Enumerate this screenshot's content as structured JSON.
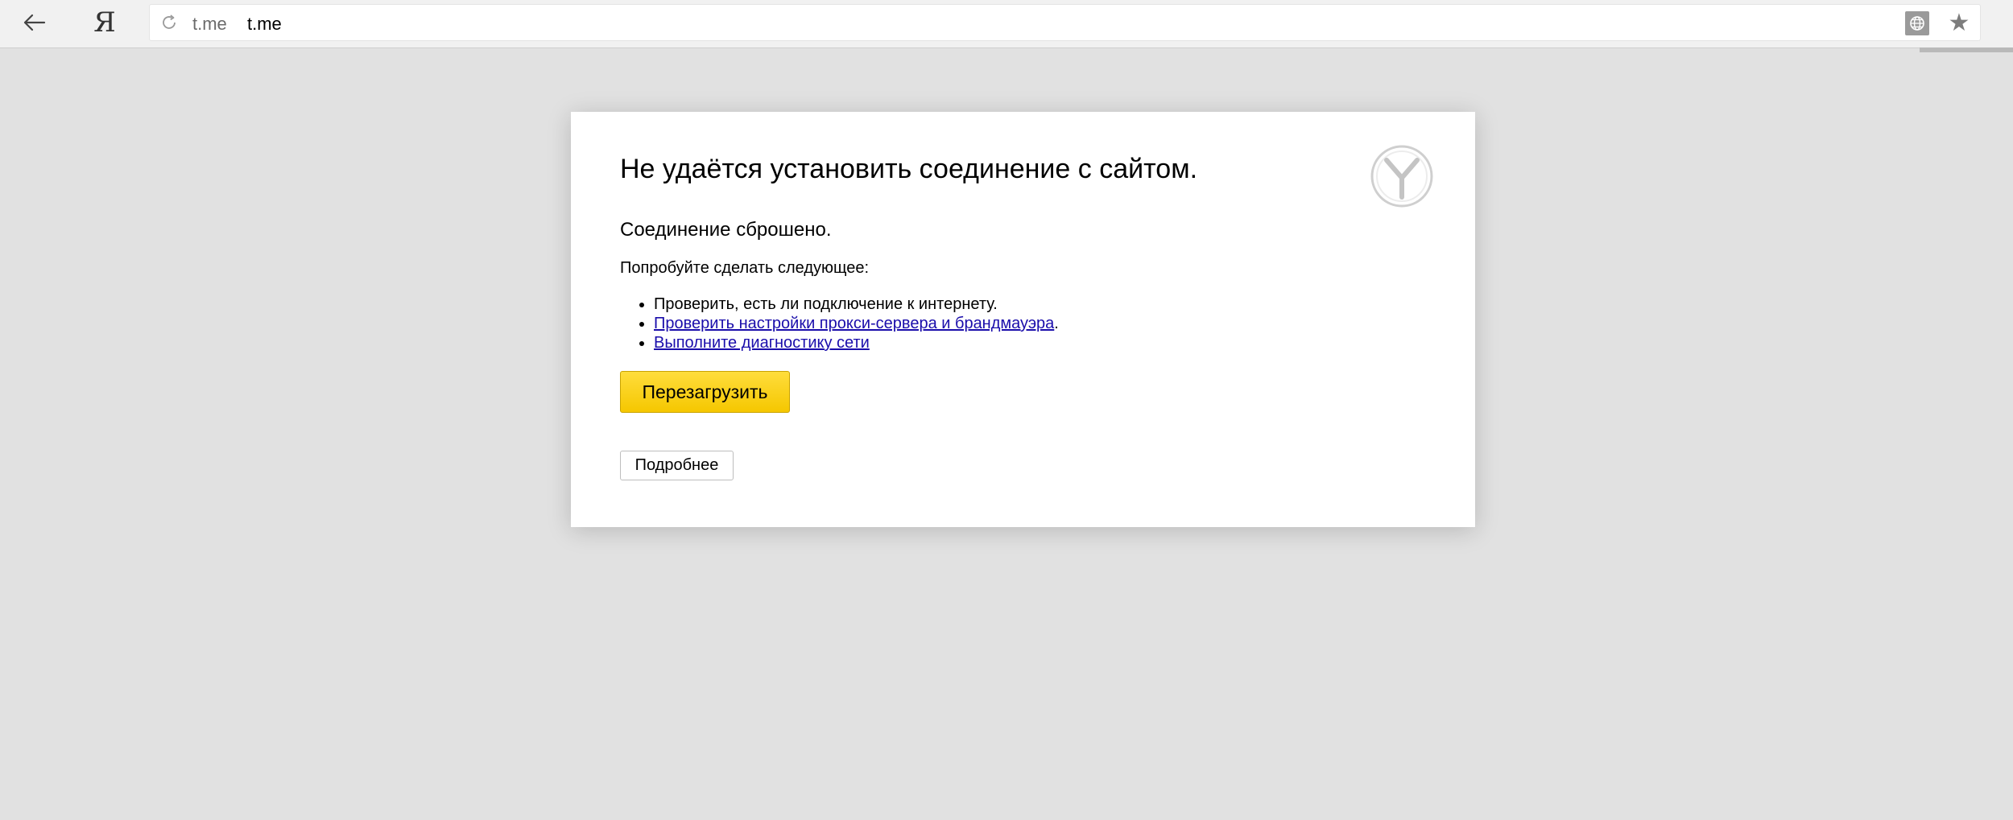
{
  "browser": {
    "back_icon": "arrow-left-icon",
    "yandex_label": "Я",
    "reload_icon": "reload-icon",
    "address": {
      "domain": "t.me",
      "url": "t.me"
    },
    "translate_icon": "globe-icon",
    "bookmark_icon": "star-icon"
  },
  "error": {
    "title": "Не удаётся установить соединение с сайтом.",
    "subtitle": "Соединение сброшено.",
    "hint": "Попробуйте сделать следующее:",
    "tips": [
      {
        "text": "Проверить, есть ли подключение к интернету.",
        "link": false
      },
      {
        "text": "Проверить настройки прокси-сервера и брандмауэра",
        "suffix": ".",
        "link": true
      },
      {
        "text": "Выполните диагностику сети",
        "link": true
      }
    ],
    "reload_button": "Перезагрузить",
    "details_button": "Подробнее",
    "logo_icon": "yandex-browser-logo-icon"
  },
  "colors": {
    "page_background": "#e1e1e1",
    "reload_button": "#fcd22a",
    "link": "#1a0dab"
  }
}
